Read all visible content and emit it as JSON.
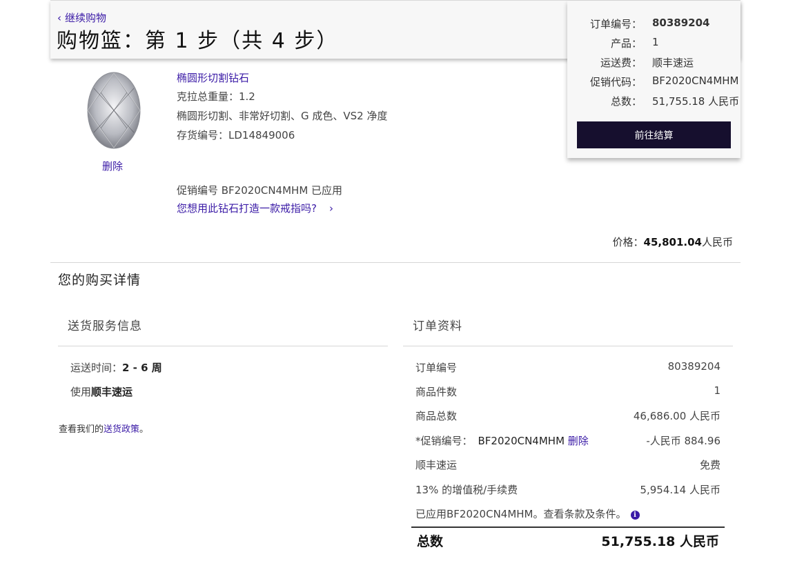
{
  "header": {
    "back_label": "继续购物",
    "title": "购物篮：第 1 步（共 4 步）"
  },
  "summary": {
    "order_no_label": "订单编号：",
    "order_no": "80389204",
    "products_label": "产品：",
    "products": "1",
    "shipping_label": "运送费：",
    "shipping": "顺丰速运",
    "promo_label": "促销代码：",
    "promo": "BF2020CN4MHM",
    "total_label": "总数：",
    "total": "51,755.18 人民币",
    "checkout_label": "前往结算"
  },
  "item": {
    "name": "椭圆形切割钻石",
    "carat": "克拉总重量：1.2",
    "spec": "椭圆形切割、非常好切割、G 成色、VS2 净度",
    "stock": "存货编号：LD14849006",
    "remove_label": "删除",
    "promo_applied": "促销编号 BF2020CN4MHM 已应用",
    "ring_prompt": "您想用此钻石打造一款戒指吗?",
    "price_label": "价格：",
    "price_value": "45,801.04",
    "price_currency": "人民币"
  },
  "details": {
    "title": "您的购买详情",
    "shipping": {
      "title": "送货服务信息",
      "time_label": "运送时间：",
      "time_value": "2 - 6 周",
      "carrier_prefix": "使用",
      "carrier": "顺丰速运",
      "policy_prefix": "查看我们的",
      "policy_link": "送货政策",
      "policy_suffix": "。"
    },
    "order": {
      "title": "订单资料",
      "rows": [
        {
          "label": "订单编号",
          "value": "80389204"
        },
        {
          "label": "商品件数",
          "value": "1"
        },
        {
          "label": "商品总数",
          "value": "46,686.00 人民币"
        },
        {
          "label": "*促销编号：",
          "value": "-人民币 884.96"
        },
        {
          "label": "顺丰速运",
          "value": "免费"
        },
        {
          "label": "13% 的增值税/手续费",
          "value": "5,954.14 人民币"
        }
      ],
      "promo_code": "BF2020CN4MHM",
      "promo_remove": "删除",
      "applied_note": "已应用BF2020CN4MHM。查看条款及条件。",
      "info_icon": "info-icon",
      "total_label": "总数",
      "total_value": "51,755.18 人民币"
    }
  },
  "colors": {
    "accent": "#3a1aa6",
    "button": "#160f2e"
  }
}
